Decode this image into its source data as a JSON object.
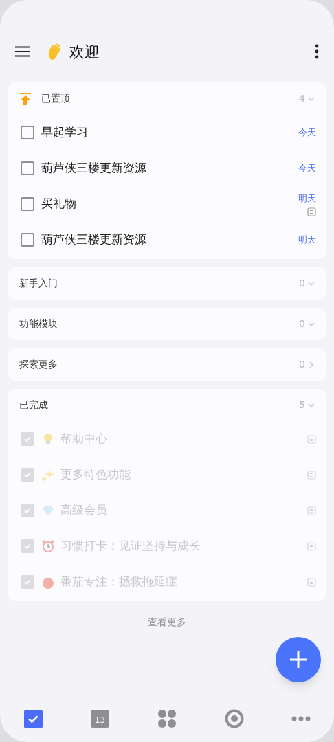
{
  "header": {
    "title": "欢迎"
  },
  "sections": [
    {
      "kind": "pinned",
      "title": "已置顶",
      "count": "4",
      "expandable": true,
      "tasks": [
        {
          "title": "早起学习",
          "checked": false,
          "due": "今天",
          "note": false
        },
        {
          "title": "葫芦侠三楼更新资源",
          "checked": false,
          "due": "今天",
          "note": false
        },
        {
          "title": "买礼物",
          "checked": false,
          "due": "明天",
          "note": true
        },
        {
          "title": "葫芦侠三楼更新资源",
          "checked": false,
          "due": "明天",
          "note": false
        }
      ]
    },
    {
      "kind": "plain",
      "title": "新手入门",
      "count": "0",
      "expandable": true
    },
    {
      "kind": "plain",
      "title": "功能模块",
      "count": "0",
      "expandable": true
    },
    {
      "kind": "plain",
      "title": "探索更多",
      "count": "0",
      "expandable": false
    },
    {
      "kind": "plain",
      "title": "已完成",
      "count": "5",
      "expandable": true,
      "tasks": [
        {
          "title": "帮助中心",
          "checked": true,
          "kind": "bulb",
          "note": true
        },
        {
          "title": "更多特色功能",
          "checked": true,
          "kind": "sparkle",
          "note": true
        },
        {
          "title": "高级会员",
          "checked": true,
          "kind": "gem",
          "note": true
        },
        {
          "title": "习惯打卡：见证坚持与成长",
          "checked": true,
          "kind": "clock",
          "note": true
        },
        {
          "title": "番茄专注：拯救拖延症",
          "checked": true,
          "kind": "tomato",
          "note": true
        }
      ]
    }
  ],
  "more_link": "查看更多",
  "nav": [
    {
      "kind": "tasks",
      "selected": true
    },
    {
      "kind": "calendar",
      "label": "13",
      "selected": false
    },
    {
      "kind": "grid",
      "selected": false
    },
    {
      "kind": "focus",
      "selected": false
    },
    {
      "kind": "more",
      "selected": false
    }
  ]
}
